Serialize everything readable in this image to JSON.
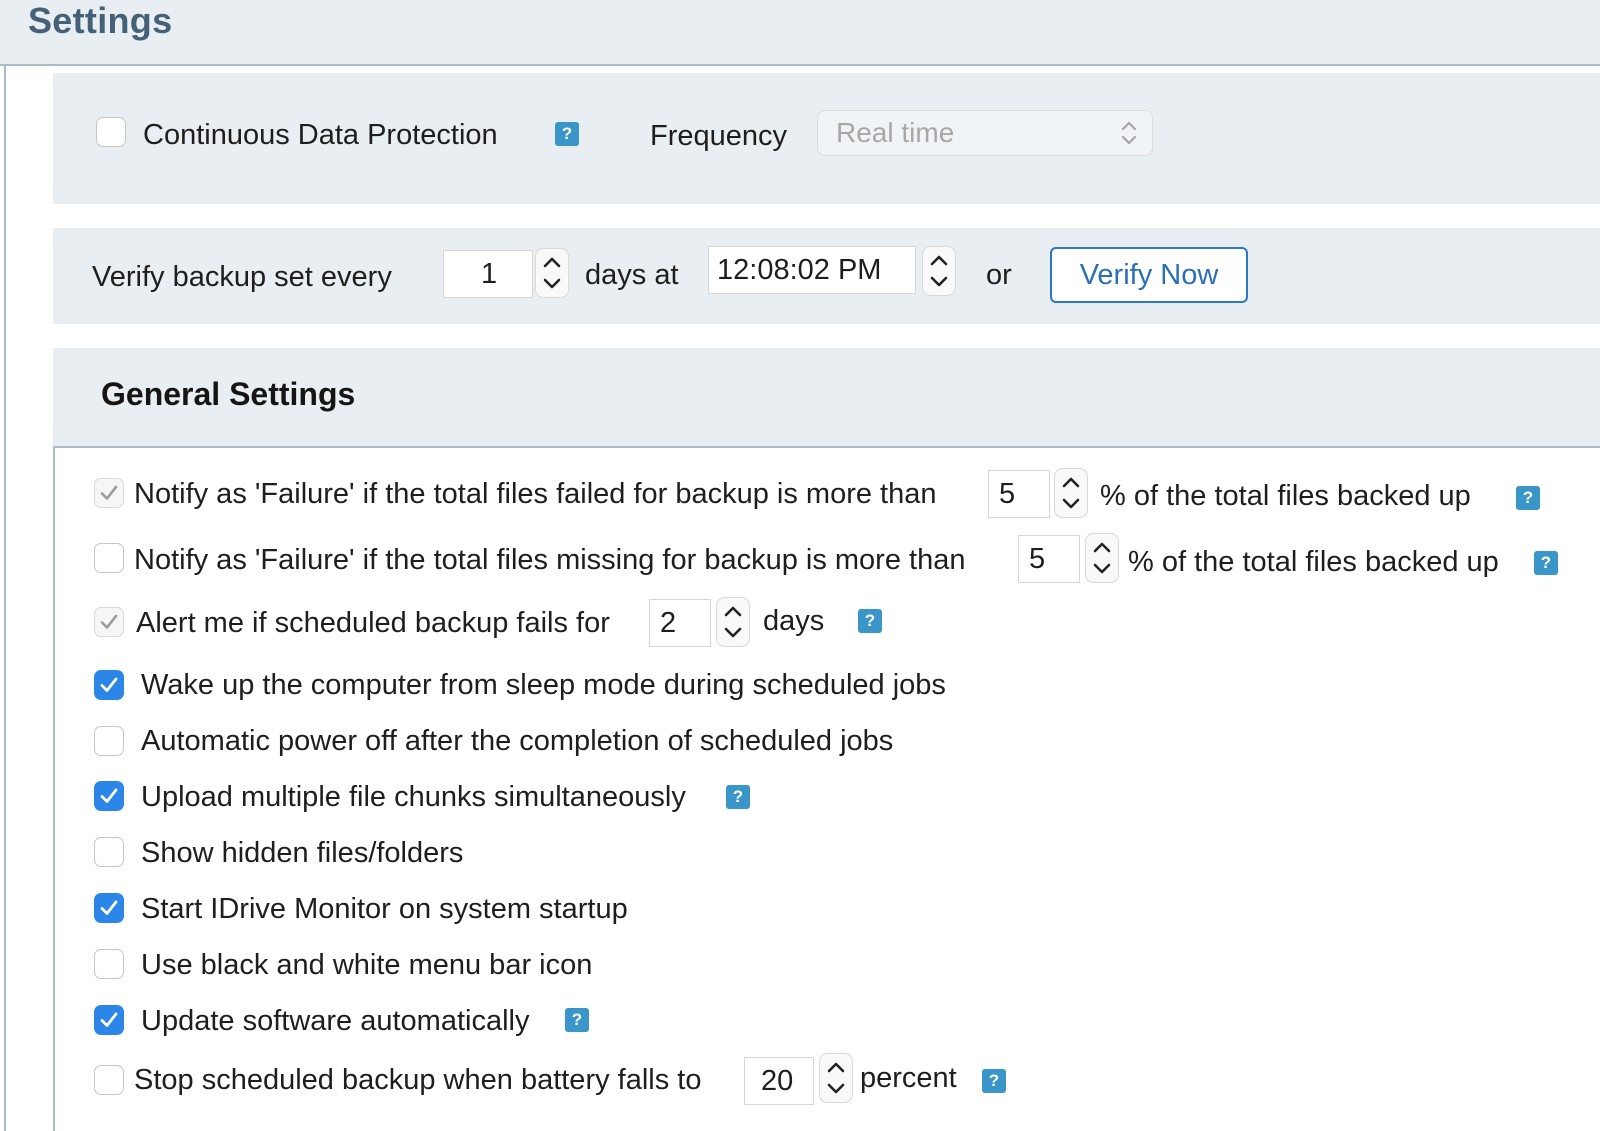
{
  "page": {
    "title": "Settings"
  },
  "cdp": {
    "checkbox_label": "Continuous Data Protection",
    "checked": false,
    "help": "?",
    "frequency_label": "Frequency",
    "frequency_value": "Real time"
  },
  "verify": {
    "prefix": "Verify backup set every",
    "days_value": "1",
    "days_at": "days at",
    "time_value": "12:08:02 PM",
    "or": "or",
    "button_label": "Verify Now"
  },
  "general": {
    "title": "General Settings",
    "help": "?",
    "failed_files": {
      "label": "Notify as 'Failure' if the total files failed for backup is more than",
      "value": "5",
      "suffix": "% of the total files backed up",
      "checked": true,
      "disabled": true
    },
    "missing_files": {
      "label": "Notify as 'Failure' if the total files missing for backup is more than",
      "value": "5",
      "suffix": "% of the total files backed up",
      "checked": false
    },
    "alert_fail": {
      "label": "Alert me if scheduled backup fails for",
      "value": "2",
      "suffix": "days",
      "checked": true,
      "disabled": true
    },
    "wake_up": {
      "label": "Wake up the computer from sleep mode during scheduled jobs",
      "checked": true
    },
    "power_off": {
      "label": "Automatic power off after the completion of scheduled jobs",
      "checked": false
    },
    "upload_chunks": {
      "label": "Upload multiple file chunks simultaneously",
      "checked": true
    },
    "hidden_files": {
      "label": "Show hidden files/folders",
      "checked": false
    },
    "start_monitor": {
      "label": "Start IDrive Monitor on system startup",
      "checked": true
    },
    "bw_icon": {
      "label": "Use black and white menu bar icon",
      "checked": false
    },
    "auto_update": {
      "label": "Update software automatically",
      "checked": true
    },
    "battery": {
      "label": "Stop scheduled backup when battery falls to",
      "value": "20",
      "suffix": "percent",
      "checked": false
    }
  },
  "colors": {
    "accent": "#2b86e8",
    "help_badge": "#3a96c8",
    "title": "#456178",
    "panel_bg": "#e9eef3"
  }
}
